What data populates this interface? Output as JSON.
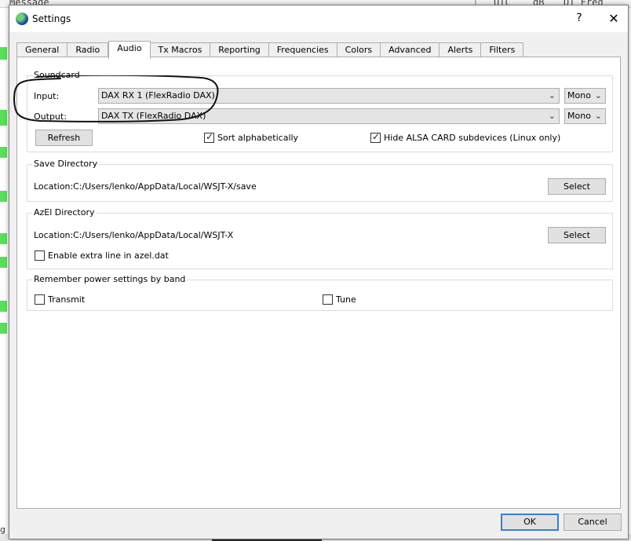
{
  "background": {
    "col_message": "Message",
    "col_utc": "UTC",
    "col_db": "dB",
    "col_dt_freq": "DT Freq",
    "bottom_fragment": "g C"
  },
  "window": {
    "title": "Settings",
    "help_glyph": "?",
    "close_glyph": "✕"
  },
  "tabs": [
    {
      "label": "General"
    },
    {
      "label": "Radio"
    },
    {
      "label": "Audio",
      "active": true
    },
    {
      "label": "Tx Macros"
    },
    {
      "label": "Reporting"
    },
    {
      "label": "Frequencies"
    },
    {
      "label": "Colors"
    },
    {
      "label": "Advanced"
    },
    {
      "label": "Alerts"
    },
    {
      "label": "Filters"
    }
  ],
  "soundcard": {
    "title": "Soundcard",
    "input_label": "Input:",
    "input_value": "DAX RX 1 (FlexRadio DAX)",
    "input_channel": "Mono",
    "output_label": "Output:",
    "output_value": "DAX TX (FlexRadio DAX)",
    "output_channel": "Mono",
    "refresh_label": "Refresh",
    "sort_label": "Sort alphabetically",
    "sort_checked": true,
    "hide_alsa_label": "Hide ALSA CARD subdevices (Linux only)",
    "hide_alsa_checked": true
  },
  "save_directory": {
    "title": "Save Directory",
    "location_label": "Location:",
    "path": "C:/Users/lenko/AppData/Local/WSJT-X/save",
    "select_label": "Select"
  },
  "azel_directory": {
    "title": "AzEl Directory",
    "location_label": "Location:",
    "path": "C:/Users/lenko/AppData/Local/WSJT-X",
    "select_label": "Select",
    "extra_line_label": "Enable extra line in azel.dat",
    "extra_line_checked": false
  },
  "power": {
    "title": "Remember power settings by band",
    "transmit_label": "Transmit",
    "transmit_checked": false,
    "tune_label": "Tune",
    "tune_checked": false
  },
  "footer": {
    "ok_label": "OK",
    "cancel_label": "Cancel"
  },
  "icons": {
    "app": "wsjtx-globe-icon",
    "dropdown": "chevron-down-icon",
    "checkmark": "checkmark-icon"
  },
  "colors": {
    "accent_focus": "#3b7fd1",
    "waterfall_green": "#58e05a",
    "annotation_ink": "#111111"
  }
}
